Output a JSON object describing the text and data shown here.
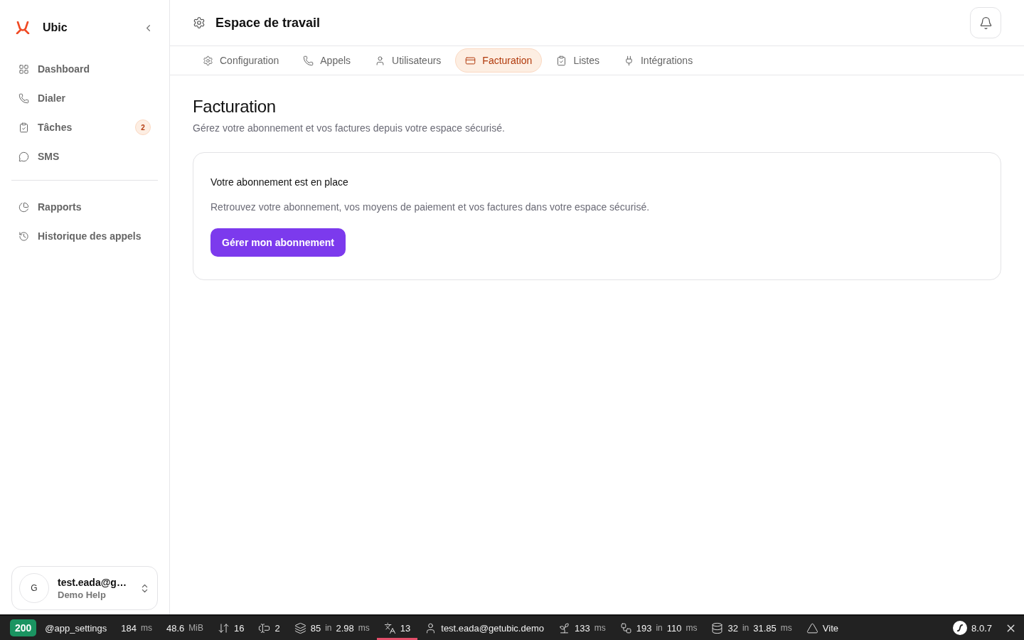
{
  "sidebar": {
    "brand": "Ubic",
    "nav": [
      {
        "label": "Dashboard",
        "selected": false
      },
      {
        "label": "Dialer",
        "selected": false
      },
      {
        "label": "Tâches",
        "selected": false,
        "badge": "2"
      },
      {
        "label": "SMS",
        "selected": false
      }
    ],
    "nav_secondary": [
      {
        "label": "Rapports",
        "selected": false
      },
      {
        "label": "Historique des appels",
        "selected": false
      }
    ],
    "user": {
      "avatar": "G",
      "name": "test.eada@g…",
      "org": "Demo Help"
    }
  },
  "header": {
    "title": "Espace de travail"
  },
  "tabs": [
    {
      "label": "Configuration",
      "selected": false
    },
    {
      "label": "Appels",
      "selected": false
    },
    {
      "label": "Utilisateurs",
      "selected": false
    },
    {
      "label": "Facturation",
      "selected": true
    },
    {
      "label": "Listes",
      "selected": false
    },
    {
      "label": "Intégrations",
      "selected": false
    }
  ],
  "page": {
    "title": "Facturation",
    "subtitle": "Gérez votre abonnement et vos factures depuis votre espace sécurisé.",
    "card": {
      "title": "Votre abonnement est en place",
      "text": "Retrouvez votre abonnement, vos moyens de paiement et vos factures dans votre espace sécurisé.",
      "button": "Gérer mon abonnement"
    }
  },
  "debug_toolbar": {
    "items": [
      {
        "kind": "status",
        "parts": [
          {
            "text": "200",
            "muted": false
          }
        ]
      },
      {
        "kind": "route",
        "parts": [
          {
            "text": "@app_settings",
            "muted": false
          }
        ]
      },
      {
        "kind": "time",
        "parts": [
          {
            "text": "184",
            "muted": false
          },
          {
            "text": "ms",
            "muted": true
          }
        ]
      },
      {
        "kind": "memory",
        "parts": [
          {
            "text": "48.6",
            "muted": false
          },
          {
            "text": "MiB",
            "muted": true
          }
        ]
      },
      {
        "kind": "requests",
        "parts": [
          {
            "text": "16",
            "muted": false
          }
        ]
      },
      {
        "kind": "forms",
        "parts": [
          {
            "text": "2",
            "muted": false
          }
        ]
      },
      {
        "kind": "cache",
        "parts": [
          {
            "text": "85",
            "muted": false
          },
          {
            "text": "in",
            "muted": true
          },
          {
            "text": "2.98",
            "muted": false
          },
          {
            "text": "ms",
            "muted": true
          }
        ]
      },
      {
        "kind": "translation",
        "selected": true,
        "parts": [
          {
            "text": "13",
            "muted": false
          }
        ]
      },
      {
        "kind": "user",
        "parts": [
          {
            "text": "test.eada@getubic.demo",
            "muted": false
          }
        ]
      },
      {
        "kind": "events",
        "parts": [
          {
            "text": "133",
            "muted": false
          },
          {
            "text": "ms",
            "muted": true
          }
        ]
      },
      {
        "kind": "listeners",
        "parts": [
          {
            "text": "193",
            "muted": false
          },
          {
            "text": "in",
            "muted": true
          },
          {
            "text": "110",
            "muted": false
          },
          {
            "text": "ms",
            "muted": true
          }
        ]
      },
      {
        "kind": "database",
        "parts": [
          {
            "text": "32",
            "muted": false
          },
          {
            "text": "in",
            "muted": true
          },
          {
            "text": "31.85",
            "muted": false
          },
          {
            "text": "ms",
            "muted": true
          }
        ]
      },
      {
        "kind": "vite",
        "parts": [
          {
            "text": "Vite",
            "muted": false
          }
        ]
      }
    ],
    "version": "8.0.7"
  }
}
